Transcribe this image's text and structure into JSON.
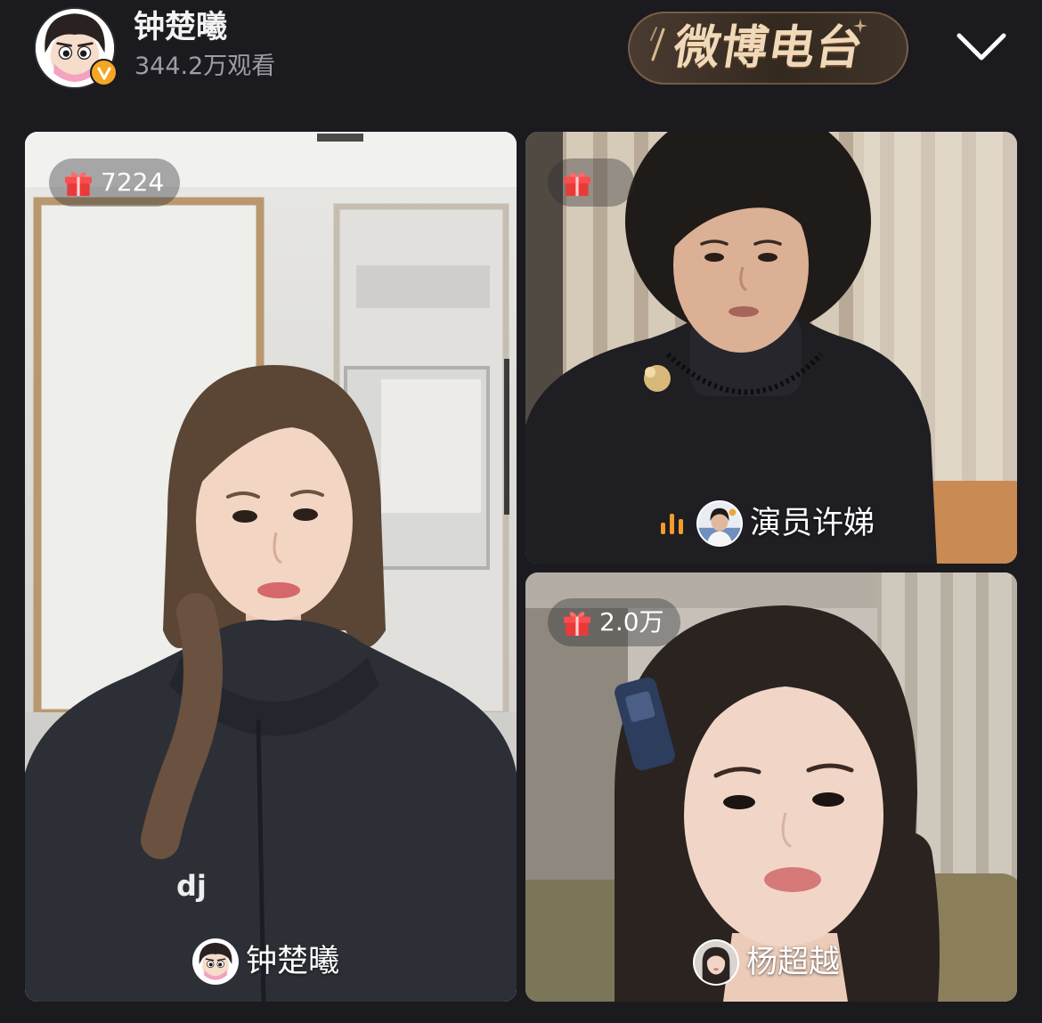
{
  "header": {
    "avatar_icon": "cartoon-avatar-icon",
    "verified_icon": "verified-v-icon",
    "host_name": "钟楚曦",
    "view_count": "344.2万观看",
    "channel_badge": "微博电台",
    "collapse_icon": "chevron-down-icon"
  },
  "tiles": [
    {
      "participant": "钟楚曦",
      "gift_icon": "gift-icon",
      "gift_count": "7224",
      "hoodie_logo": "dj"
    },
    {
      "participant": "演员许娣",
      "gift_icon": "gift-icon",
      "speaking_icon": "audio-level-icon"
    },
    {
      "participant": "杨超越",
      "gift_icon": "gift-icon",
      "gift_count": "2.0万"
    }
  ],
  "colors": {
    "background": "#1a1a1f",
    "badge_gold": "#f0d9b8",
    "gift_red": "#e93a3a",
    "speaking_orange": "#f59a2c",
    "verified_orange": "#f5a623"
  }
}
